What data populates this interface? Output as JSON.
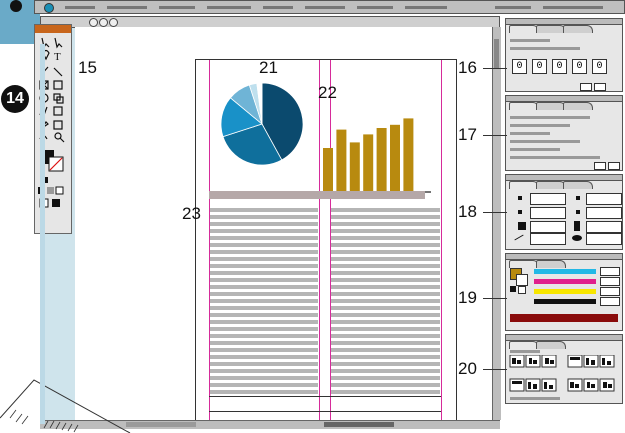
{
  "callouts": {
    "c14": "14",
    "c15": "15",
    "c16": "16",
    "c17": "17",
    "c18": "18",
    "c19": "19",
    "c20": "20",
    "c21": "21",
    "c22": "22",
    "c23": "23"
  },
  "panel16": {
    "numbers": [
      "0",
      "0",
      "0",
      "0",
      "0"
    ]
  },
  "colors": {
    "accent_blue": "#6aaac8",
    "guide_magenta": "#d62b9a",
    "bar_gold": "#b88a0f",
    "cyan": "#22b8e6",
    "magenta": "#e0208c",
    "yellow": "#f7e600",
    "black": "#111111",
    "dark_red": "#8a0c0c"
  },
  "chart_data": [
    {
      "type": "pie",
      "values": [
        42,
        28,
        16,
        9,
        3,
        2
      ],
      "colors": [
        "#0b4a6e",
        "#0f6f9c",
        "#1991c8",
        "#6fb4d6",
        "#bfe0ee",
        "#ffffff"
      ]
    },
    {
      "type": "bar",
      "values": [
        55,
        78,
        62,
        72,
        80,
        84,
        92
      ],
      "ylim": [
        0,
        100
      ],
      "color": "#b88a0f"
    }
  ]
}
